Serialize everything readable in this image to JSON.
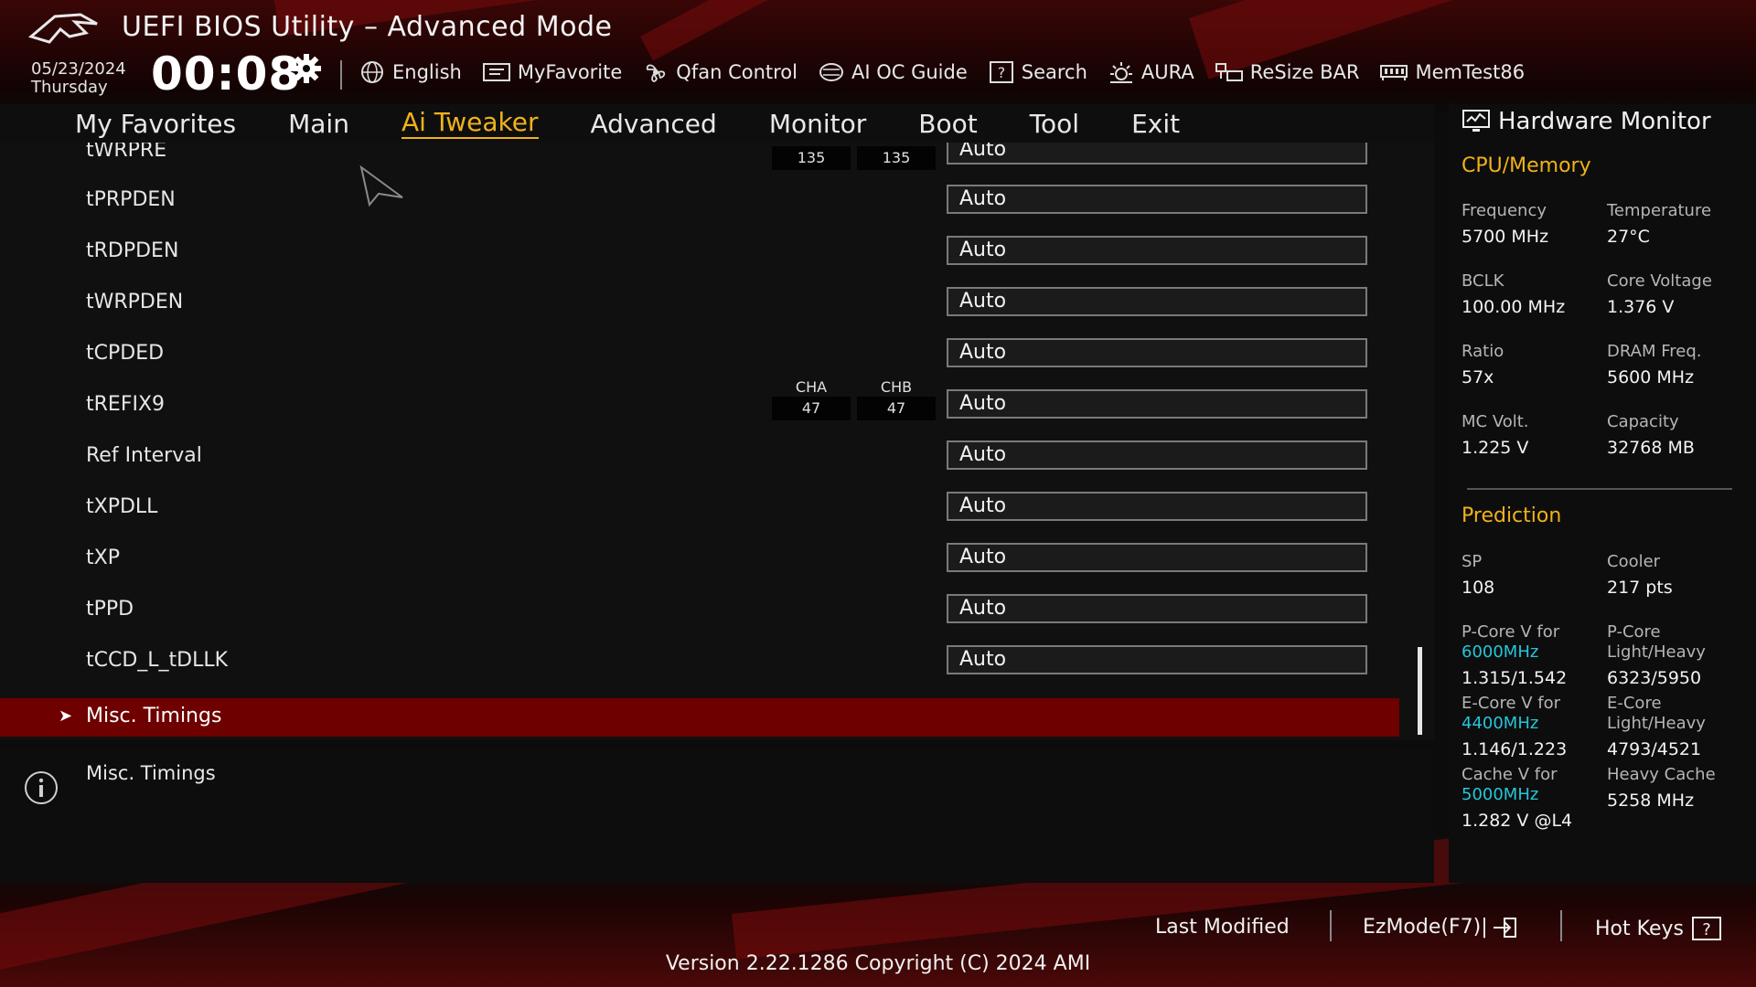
{
  "header": {
    "title": "UEFI BIOS Utility – Advanced Mode",
    "date": "05/23/2024",
    "weekday": "Thursday",
    "time": "00:08",
    "tools": [
      {
        "label": "English",
        "icon": "globe-icon"
      },
      {
        "label": "MyFavorite",
        "icon": "favorite-icon"
      },
      {
        "label": "Qfan Control",
        "icon": "fan-icon"
      },
      {
        "label": "AI OC Guide",
        "icon": "ai-guide-icon"
      },
      {
        "label": "Search",
        "icon": "search-question-icon"
      },
      {
        "label": "AURA",
        "icon": "aura-icon"
      },
      {
        "label": "ReSize BAR",
        "icon": "resize-bar-icon"
      },
      {
        "label": "MemTest86",
        "icon": "memory-icon"
      }
    ]
  },
  "nav": {
    "tabs": [
      "My Favorites",
      "Main",
      "Ai Tweaker",
      "Advanced",
      "Monitor",
      "Boot",
      "Tool",
      "Exit"
    ],
    "active": "Ai Tweaker"
  },
  "settings": {
    "rows": [
      {
        "label": "tWRPRE",
        "value": "Auto",
        "cha": "135",
        "chb": "135"
      },
      {
        "label": "tPRPDEN",
        "value": "Auto"
      },
      {
        "label": "tRDPDEN",
        "value": "Auto"
      },
      {
        "label": "tWRPDEN",
        "value": "Auto"
      },
      {
        "label": "tCPDED",
        "value": "Auto"
      },
      {
        "label": "tREFIX9",
        "value": "Auto",
        "cha_header": "CHA",
        "chb_header": "CHB",
        "cha": "47",
        "chb": "47"
      },
      {
        "label": "Ref Interval",
        "value": "Auto"
      },
      {
        "label": "tXPDLL",
        "value": "Auto"
      },
      {
        "label": "tXP",
        "value": "Auto"
      },
      {
        "label": "tPPD",
        "value": "Auto"
      },
      {
        "label": "tCCD_L_tDLLK",
        "value": "Auto"
      }
    ],
    "selected_item": "Misc. Timings"
  },
  "help": {
    "text": "Misc. Timings"
  },
  "hardware_monitor": {
    "title": "Hardware Monitor",
    "cpu_memory_title": "CPU/Memory",
    "frequency_label": "Frequency",
    "frequency": "5700 MHz",
    "temperature_label": "Temperature",
    "temperature": "27°C",
    "bclk_label": "BCLK",
    "bclk": "100.00 MHz",
    "core_voltage_label": "Core Voltage",
    "core_voltage": "1.376 V",
    "ratio_label": "Ratio",
    "ratio": "57x",
    "dram_freq_label": "DRAM Freq.",
    "dram_freq": "5600 MHz",
    "mc_volt_label": "MC Volt.",
    "mc_volt": "1.225 V",
    "capacity_label": "Capacity",
    "capacity": "32768 MB",
    "prediction_title": "Prediction",
    "sp_label": "SP",
    "sp": "108",
    "cooler_label": "Cooler",
    "cooler": "217 pts",
    "pcore_v_label": "P-Core V for",
    "pcore_v_freq": "6000MHz",
    "pcore_v": "1.315/1.542",
    "pcore_lh_label1": "P-Core",
    "pcore_lh_label2": "Light/Heavy",
    "pcore_lh": "6323/5950",
    "ecore_v_label": "E-Core V for",
    "ecore_v_freq": "4400MHz",
    "ecore_v": "1.146/1.223",
    "ecore_lh_label1": "E-Core",
    "ecore_lh_label2": "Light/Heavy",
    "ecore_lh": "4793/4521",
    "cache_v_label": "Cache V for",
    "cache_v_freq": "5000MHz",
    "cache_v": "1.282 V @L4",
    "heavy_cache_label": "Heavy Cache",
    "heavy_cache": "5258 MHz"
  },
  "footer": {
    "last_modified": "Last Modified",
    "ezmode": "EzMode(F7)|",
    "hot_keys": "Hot Keys",
    "version": "Version 2.22.1286 Copyright (C) 2024 AMI"
  },
  "colors": {
    "accent": "#f0b21a",
    "selected_row": "#6e0000",
    "highlight_freq": "#25c6d9"
  }
}
